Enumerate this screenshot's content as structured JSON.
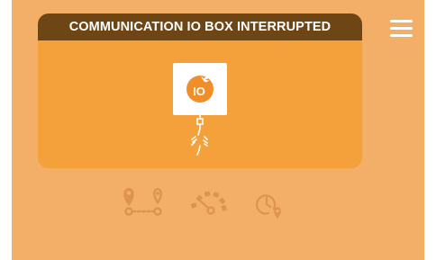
{
  "card": {
    "title": "COMMUNICATION IO BOX INTERRUPTED"
  },
  "io_badge": {
    "text": "IO"
  },
  "icons": {
    "menu": "hamburger-menu-icon",
    "io_box": "io-box-icon",
    "broken_cable": "broken-cable-icon",
    "route": "route-icon",
    "speedometer": "speedometer-icon",
    "location_time": "clock-location-icon"
  },
  "colors": {
    "background": "#f3ae67",
    "card": "#f4a03b",
    "header": "#6e4616",
    "icon_muted": "#dc9450",
    "io_orange": "#f08f2a"
  }
}
